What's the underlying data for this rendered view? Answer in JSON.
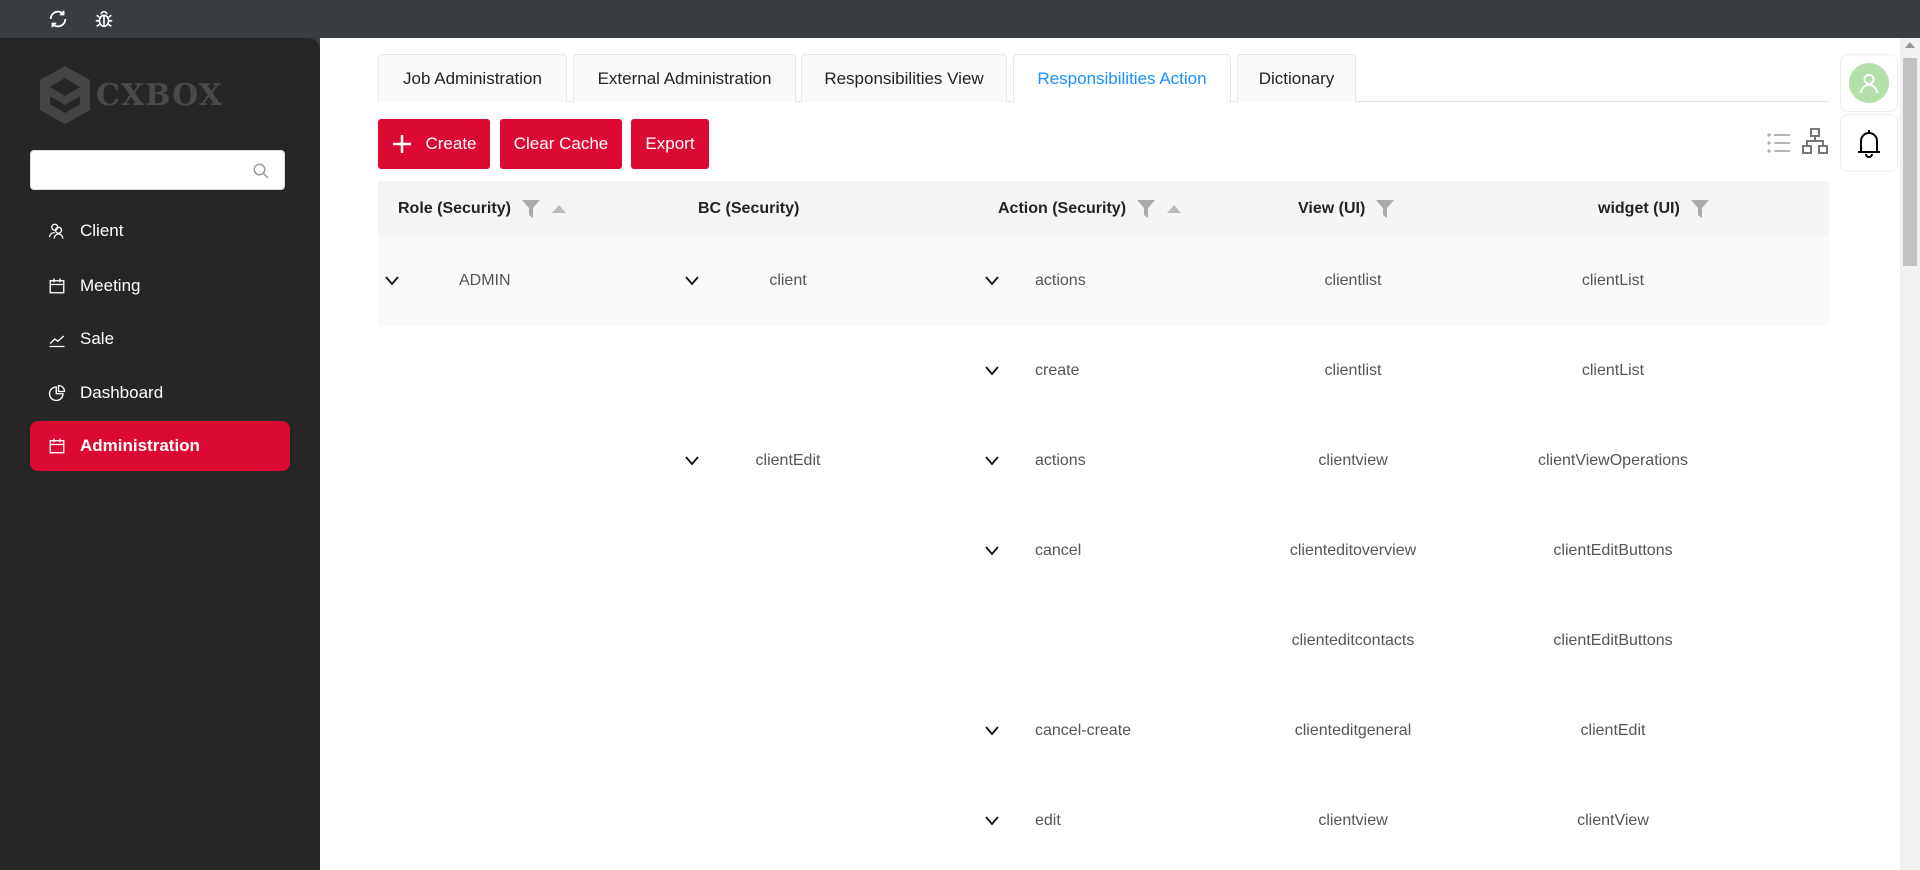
{
  "topbar": {
    "icons": [
      "refresh-icon",
      "bug-icon"
    ]
  },
  "sidebar": {
    "logo": "CXBOX",
    "search_placeholder": "",
    "items": [
      {
        "label": "Client",
        "icon": "users-icon"
      },
      {
        "label": "Meeting",
        "icon": "calendar-icon"
      },
      {
        "label": "Sale",
        "icon": "line-chart-icon"
      },
      {
        "label": "Dashboard",
        "icon": "pie-chart-icon"
      },
      {
        "label": "Administration",
        "icon": "calendar-icon",
        "active": true
      }
    ]
  },
  "tabs": [
    {
      "label": "Job Administration"
    },
    {
      "label": "External Administration"
    },
    {
      "label": "Responsibilities View"
    },
    {
      "label": "Responsibilities Action",
      "active": true
    },
    {
      "label": "Dictionary"
    }
  ],
  "toolbar": {
    "create": "Create",
    "clear_cache": "Clear Cache",
    "export": "Export"
  },
  "colors": {
    "accent": "#dc0a33",
    "active_tab": "#1890ff",
    "avatar": "#b3dfa9"
  },
  "table": {
    "columns": [
      "Role (Security)",
      "BC (Security)",
      "Action (Security)",
      "View (UI)",
      "widget (UI)"
    ],
    "rows": [
      {
        "role": "ADMIN",
        "bc": "client",
        "action": "actions",
        "view": "clientlist",
        "widget": "clientList"
      },
      {
        "role": "",
        "bc": "",
        "action": "create",
        "view": "clientlist",
        "widget": "clientList"
      },
      {
        "role": "",
        "bc": "clientEdit",
        "action": "actions",
        "view": "clientview",
        "widget": "clientViewOperations"
      },
      {
        "role": "",
        "bc": "",
        "action": "cancel",
        "view": "clienteditoverview",
        "widget": "clientEditButtons"
      },
      {
        "role": "",
        "bc": "",
        "action": "",
        "view": "clienteditcontacts",
        "widget": "clientEditButtons"
      },
      {
        "role": "",
        "bc": "",
        "action": "cancel-create",
        "view": "clienteditgeneral",
        "widget": "clientEdit"
      },
      {
        "role": "",
        "bc": "",
        "action": "edit",
        "view": "clientview",
        "widget": "clientView"
      }
    ]
  }
}
